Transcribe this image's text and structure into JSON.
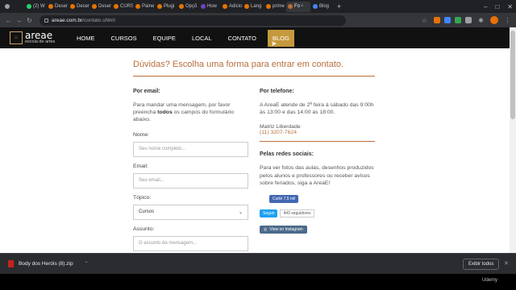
{
  "browser": {
    "tabs": [
      {
        "label": "",
        "color": "#9aa0a6"
      },
      {
        "label": "(2) W",
        "color": "#25d366"
      },
      {
        "label": "Desen",
        "color": "#e37400"
      },
      {
        "label": "Desen",
        "color": "#e37400"
      },
      {
        "label": "Desen",
        "color": "#e37400"
      },
      {
        "label": "CURS",
        "color": "#e37400"
      },
      {
        "label": "Paine",
        "color": "#e37400"
      },
      {
        "label": "Plugi",
        "color": "#e37400"
      },
      {
        "label": "Opçõ",
        "color": "#e37400"
      },
      {
        "label": "How",
        "color": "#6f42c1"
      },
      {
        "label": "Adicio",
        "color": "#e37400"
      },
      {
        "label": "Lang",
        "color": "#e37400"
      },
      {
        "label": "prime",
        "color": "#e37400"
      },
      {
        "label": "Fo",
        "color": "#b86e3a"
      },
      {
        "label": "Blog",
        "color": "#4285f4"
      }
    ],
    "address": {
      "host": "areae.com.br",
      "path": "/contato.shtml"
    },
    "new_tab": "+",
    "window_controls": [
      "–",
      "□",
      "✕"
    ]
  },
  "site": {
    "logo_main": "areae",
    "logo_sub": "escola de artes",
    "nav": [
      "HOME",
      "CURSOS",
      "EQUIPE",
      "LOCAL",
      "CONTATO",
      "BLOG"
    ],
    "nav_current": "BLOG"
  },
  "content": {
    "heading": "Dúvidas? Escolha uma forma para entrar em contato.",
    "email": {
      "title": "Por email:",
      "text_before": "Para mandar uma mensagem, por favor preencha ",
      "text_bold": "todos",
      "text_after": " os campos do formulário abaixo.",
      "fields": [
        {
          "label": "Nome:",
          "placeholder": "Seu nome completo..."
        },
        {
          "label": "Email:",
          "placeholder": "Seu email..."
        }
      ],
      "topic_label": "Tópico:",
      "topic_value": "Cursos",
      "subject_label": "Assunto:",
      "subject_placeholder": "O assunto da mensagem..."
    },
    "phone": {
      "title": "Por telefone:",
      "text": "A AreaE atende de 2ª feira à sábado das 9:00h às 13:00 e das 14:00 às 18:00.",
      "branch": "Matriz Liberdade",
      "number": "(11) 3207-7624"
    },
    "social": {
      "title": "Pelas redes sociais:",
      "text": "Para ver fotos das aulas, desenhos produzidos pelos alunos e professores ou receber avisos sobre feriados, siga a AreaE!",
      "fb_label": "Curtir 7,5 mil",
      "tw_label": "Seguir",
      "tw_count": "443 seguidores",
      "ig_label": "View on Instagram"
    }
  },
  "downloads": {
    "file": "Body dos Heróis (8).zip",
    "show_all": "Exibir todos"
  },
  "watermark": "Udemy"
}
